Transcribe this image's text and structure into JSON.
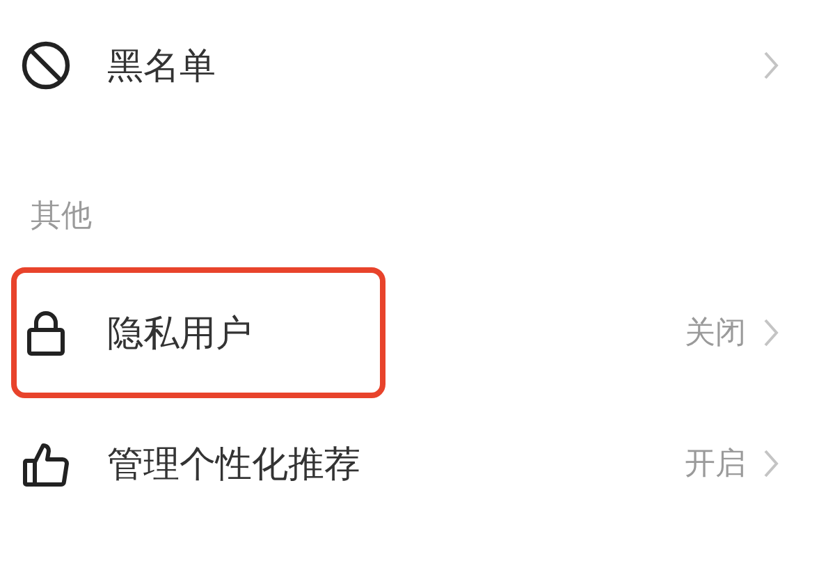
{
  "sections": [
    {
      "items": [
        {
          "kind": "block",
          "label": "黑名单",
          "highlighted": false
        }
      ]
    },
    {
      "title": "其他",
      "items": [
        {
          "kind": "lock",
          "label": "隐私用户",
          "value": "关闭",
          "highlighted": true
        },
        {
          "kind": "thumb",
          "label": "管理个性化推荐",
          "value": "开启",
          "highlighted": false
        }
      ]
    }
  ]
}
